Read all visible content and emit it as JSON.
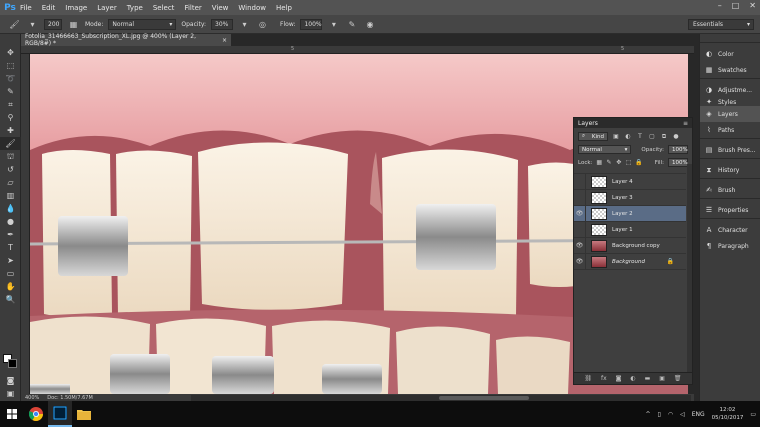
{
  "menubar": {
    "logo": "Ps",
    "items": [
      "File",
      "Edit",
      "Image",
      "Layer",
      "Type",
      "Select",
      "Filter",
      "View",
      "Window",
      "Help"
    ],
    "window_controls": [
      "–",
      "□",
      "✕"
    ]
  },
  "options": {
    "brush_size": "200",
    "mode_label": "Mode:",
    "mode_value": "Normal",
    "opacity_label": "Opacity:",
    "opacity_value": "30%",
    "flow_label": "Flow:",
    "flow_value": "100%",
    "workspace": "Essentials"
  },
  "document": {
    "tab_title": "Fotolia_31466663_Subscription_XL.jpg @ 400% (Layer 2, RGB/8#) *",
    "tab_close": "×",
    "ruler_marks": [
      "5",
      "5"
    ],
    "zoom": "400%",
    "doc_info": "Doc: 1.50M/7.67M"
  },
  "right_dock": {
    "items": [
      {
        "label": "Color",
        "icon": "color-icon"
      },
      {
        "label": "Swatches",
        "icon": "swatches-icon"
      },
      {
        "label": "Adjustme...",
        "icon": "adjustments-icon"
      },
      {
        "label": "Styles",
        "icon": "styles-icon"
      },
      {
        "label": "Layers",
        "icon": "layers-icon"
      },
      {
        "label": "Paths",
        "icon": "paths-icon"
      },
      {
        "label": "Brush Pres...",
        "icon": "brush-presets-icon"
      },
      {
        "label": "History",
        "icon": "history-icon"
      },
      {
        "label": "Brush",
        "icon": "brush-icon"
      },
      {
        "label": "Properties",
        "icon": "properties-icon"
      },
      {
        "label": "Character",
        "icon": "character-icon"
      },
      {
        "label": "Paragraph",
        "icon": "paragraph-icon"
      }
    ]
  },
  "layers_panel": {
    "title": "Layers",
    "filter_kind": "Kind",
    "blend_mode": "Normal",
    "opacity_label": "Opacity:",
    "opacity_value": "100%",
    "lock_label": "Lock:",
    "fill_label": "Fill:",
    "fill_value": "100%",
    "layers": [
      {
        "name": "Layer 4",
        "visible": false,
        "selected": false,
        "thumb": "transparent"
      },
      {
        "name": "Layer 3",
        "visible": false,
        "selected": false,
        "thumb": "transparent"
      },
      {
        "name": "Layer 2",
        "visible": true,
        "selected": true,
        "thumb": "transparent"
      },
      {
        "name": "Layer 1",
        "visible": false,
        "selected": false,
        "thumb": "transparent"
      },
      {
        "name": "Background copy",
        "visible": true,
        "selected": false,
        "thumb": "image"
      },
      {
        "name": "Background",
        "visible": true,
        "selected": false,
        "thumb": "image",
        "locked": true
      }
    ]
  },
  "taskbar": {
    "language": "ENG",
    "time": "12:02",
    "date": "05/10/2017"
  }
}
